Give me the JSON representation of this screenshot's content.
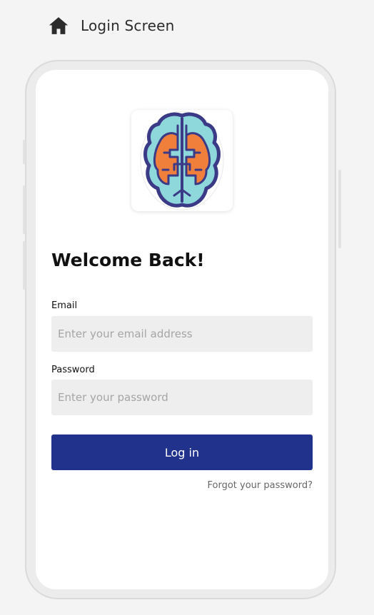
{
  "header": {
    "icon": "home-icon",
    "title": "Login Screen"
  },
  "logo": {
    "icon": "brain-icon",
    "colors": {
      "outline": "#3b3a86",
      "fill_outer": "#8ed8dc",
      "fill_inner": "#f07f3c"
    }
  },
  "form": {
    "heading": "Welcome Back!",
    "email": {
      "label": "Email",
      "placeholder": "Enter your email address",
      "value": ""
    },
    "password": {
      "label": "Password",
      "placeholder": "Enter your password",
      "value": ""
    },
    "login_label": "Log in",
    "forgot_label": "Forgot your password?"
  },
  "colors": {
    "primary": "#21328c",
    "input_bg": "#eeeeee",
    "page_bg": "#f4f4f4"
  }
}
